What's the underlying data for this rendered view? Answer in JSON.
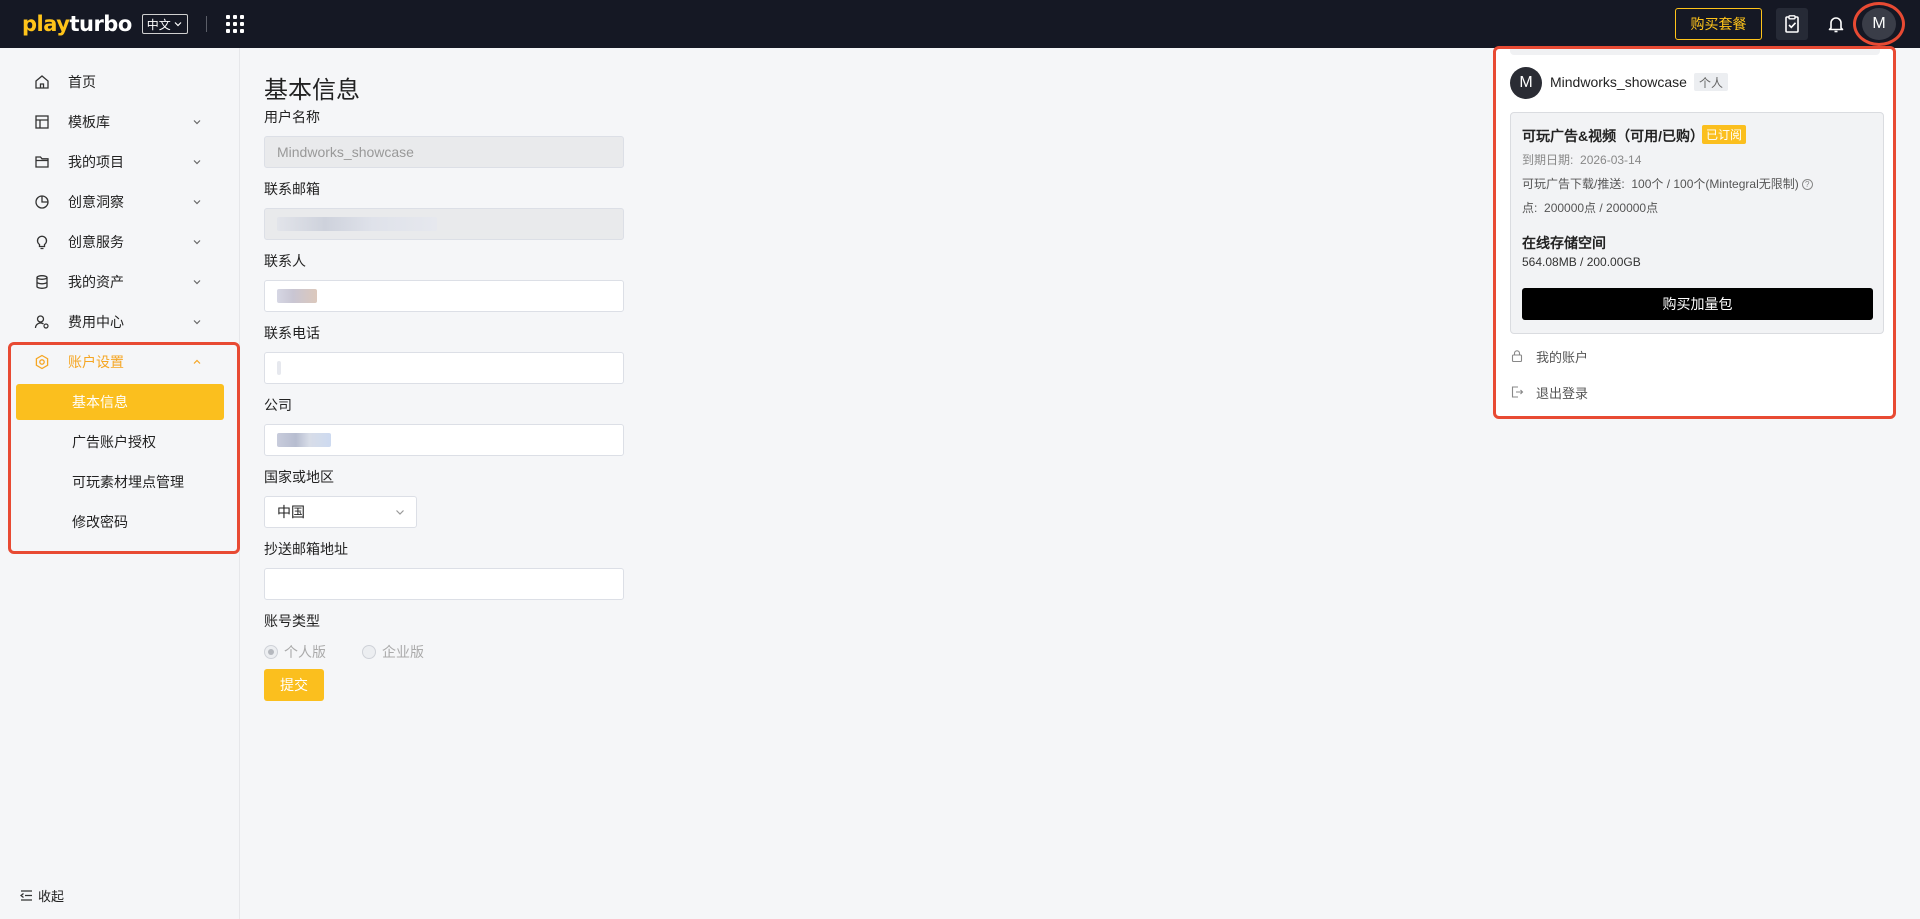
{
  "topbar": {
    "logo_prefix": "play",
    "logo_suffix": "turbo",
    "language": "中文",
    "buy_plan": "购买套餐",
    "avatar_letter": "M"
  },
  "sidebar": {
    "items": [
      {
        "label": "首页",
        "icon": "home-icon",
        "has_chevron": false
      },
      {
        "label": "模板库",
        "icon": "template-icon",
        "has_chevron": true
      },
      {
        "label": "我的项目",
        "icon": "folder-icon",
        "has_chevron": true
      },
      {
        "label": "创意洞察",
        "icon": "pie-chart-icon",
        "has_chevron": true
      },
      {
        "label": "创意服务",
        "icon": "lightbulb-icon",
        "has_chevron": true
      },
      {
        "label": "我的资产",
        "icon": "database-icon",
        "has_chevron": true
      },
      {
        "label": "费用中心",
        "icon": "user-settings-icon",
        "has_chevron": true
      },
      {
        "label": "账户设置",
        "icon": "settings-icon",
        "has_chevron": true,
        "expanded": true
      }
    ],
    "subitems": [
      "基本信息",
      "广告账户授权",
      "可玩素材埋点管理",
      "修改密码"
    ],
    "selected_subitem": "基本信息",
    "collapse_label": "收起"
  },
  "form": {
    "title": "基本信息",
    "username_label": "用户名称",
    "username_value": "Mindworks_showcase",
    "email_label": "联系邮箱",
    "contact_label": "联系人",
    "phone_label": "联系电话",
    "company_label": "公司",
    "country_label": "国家或地区",
    "country_value": "中国",
    "cc_email_label": "抄送邮箱地址",
    "account_type_label": "账号类型",
    "account_type_options": [
      "个人版",
      "企业版"
    ],
    "account_type_selected": "个人版",
    "submit_label": "提交"
  },
  "panel": {
    "avatar_letter": "M",
    "username": "Mindworks_showcase",
    "user_tag": "个人",
    "plan_title": "可玩广告&视频（可用/已购）",
    "plan_badge": "已订阅",
    "expiry_label": "到期日期:",
    "expiry_value": "2026-03-14",
    "downloads_label": "可玩广告下载/推送:",
    "downloads_value": "100个 / 100个(Mintegral无限制)",
    "points_label": "点:",
    "points_value": "200000点 / 200000点",
    "storage_title": "在线存储空间",
    "storage_value": "564.08MB / 200.00GB",
    "buy_addon": "购买加量包",
    "links": [
      "我的账户",
      "退出登录"
    ]
  },
  "colors": {
    "topbar_bg": "#151824",
    "accent": "#fbbf1e",
    "highlight_annotation": "#e84a33"
  }
}
